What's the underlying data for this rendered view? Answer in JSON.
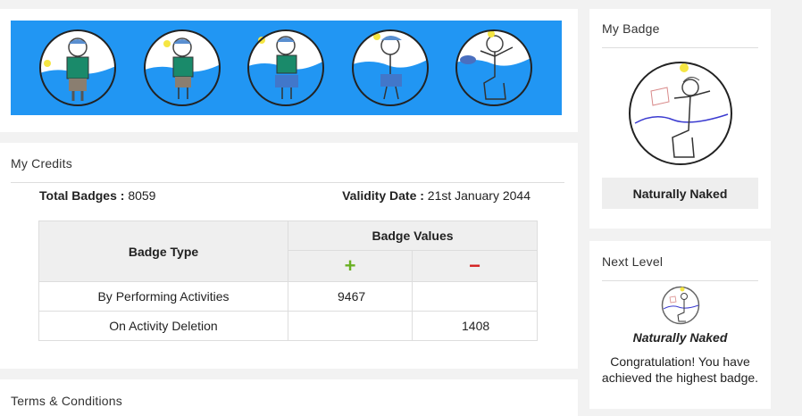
{
  "levels": [
    {
      "name": "level-1-badge"
    },
    {
      "name": "level-2-badge"
    },
    {
      "name": "level-3-badge"
    },
    {
      "name": "level-4-badge"
    },
    {
      "name": "level-5-badge"
    }
  ],
  "credits": {
    "title": "My Credits",
    "total_label": "Total Badges :",
    "total_value": "8059",
    "validity_label": "Validity Date :",
    "validity_value": "21st January 2044",
    "table": {
      "col_type": "Badge Type",
      "col_values": "Badge Values",
      "plus_symbol": "+",
      "minus_symbol": "−",
      "rows": [
        {
          "type": "By Performing Activities",
          "plus": "9467",
          "minus": ""
        },
        {
          "type": "On Activity Deletion",
          "plus": "",
          "minus": "1408"
        }
      ]
    }
  },
  "terms": {
    "title": "Terms & Conditions"
  },
  "my_badge": {
    "title": "My Badge",
    "name": "Naturally Naked"
  },
  "next_level": {
    "title": "Next Level",
    "name": "Naturally Naked",
    "message": "Congratulation! You have achieved the highest badge."
  },
  "colors": {
    "banner": "#2196f3",
    "plus": "#6ab023",
    "minus": "#d42020"
  }
}
